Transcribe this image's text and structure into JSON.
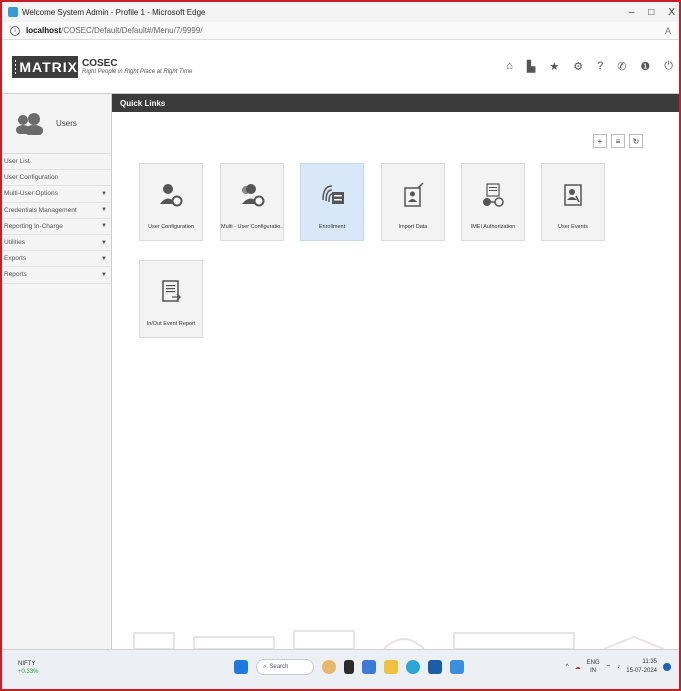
{
  "window": {
    "title": "Welcome System Admin - Profile 1 - Microsoft Edge",
    "controls": [
      "–",
      "□",
      "X"
    ]
  },
  "address": {
    "host": "localhost",
    "path": "/COSEC/Default/Default#/Menu/7/9999/"
  },
  "brand": {
    "logo": "MATRIX",
    "product": "COSEC",
    "tagline": "Right People in Right Place at Right Time"
  },
  "header_icons": [
    "home-icon",
    "chart-icon",
    "star-icon",
    "gear-icon",
    "help-icon",
    "phone-icon",
    "info-icon",
    "power-icon"
  ],
  "sidebar": {
    "section": "Users",
    "items": [
      {
        "label": "User List",
        "arrow": ""
      },
      {
        "label": "User Configuration",
        "arrow": ""
      },
      {
        "label": "Multi-User Options",
        "arrow": "▼"
      },
      {
        "label": "Credentials Management",
        "arrow": "▼"
      },
      {
        "label": "Reporting In-Charge",
        "arrow": "▼"
      },
      {
        "label": "Utilities",
        "arrow": "▼"
      },
      {
        "label": "Exports",
        "arrow": "▼"
      },
      {
        "label": "Reports",
        "arrow": "▼"
      }
    ]
  },
  "quick_links": {
    "title": "Quick Links",
    "toolbar": [
      "+",
      "≡",
      "↻"
    ],
    "tiles": [
      {
        "label": "User Configuration",
        "icon": "user-gear-icon",
        "active": false
      },
      {
        "label": "Multi - User Configuratio..",
        "icon": "multi-user-gear-icon",
        "active": false
      },
      {
        "label": "Enrollment",
        "icon": "fingerprint-card-icon",
        "active": true
      },
      {
        "label": "Import Data",
        "icon": "import-data-icon",
        "active": false
      },
      {
        "label": "IMEI Authorization",
        "icon": "imei-icon",
        "active": false
      },
      {
        "label": "User Events",
        "icon": "user-events-icon",
        "active": false
      },
      {
        "label": "In/Out Event Report",
        "icon": "report-icon",
        "active": false
      }
    ]
  },
  "taskbar": {
    "ticker_name": "NIFTY",
    "ticker_change": "+0.33%",
    "search_placeholder": "Search",
    "lang": "ENG",
    "region": "IN",
    "time": "11:35",
    "date": "15-07-2024"
  },
  "colors": {
    "accent_bar": "#3b3b3b",
    "active_tile": "#d8e8f8",
    "border": "#c62026"
  }
}
